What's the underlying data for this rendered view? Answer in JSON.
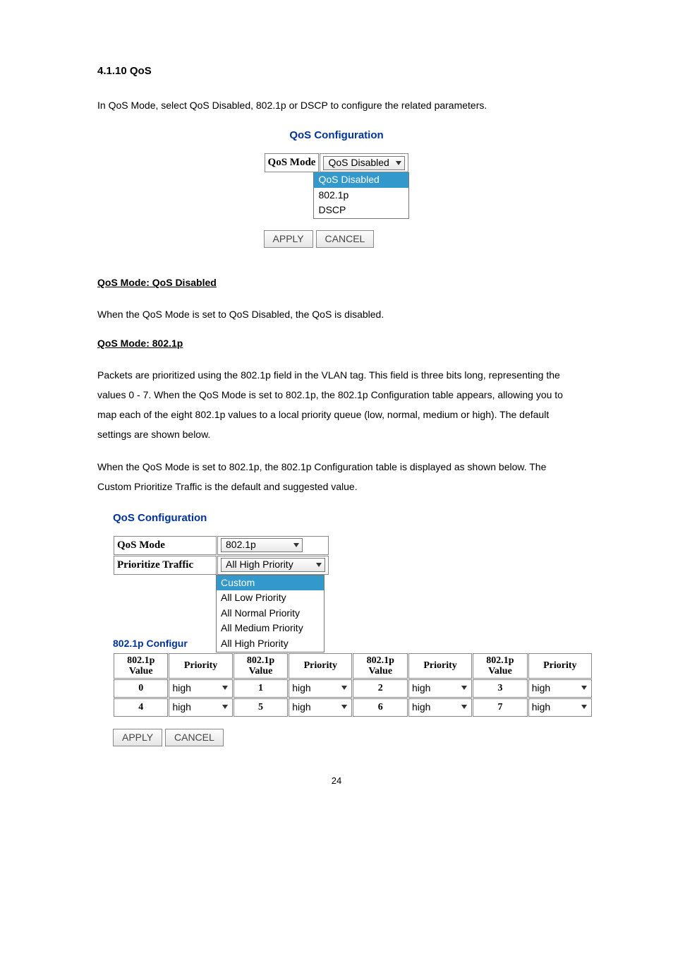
{
  "section_heading": "4.1.10 QoS",
  "intro_text": "In QoS Mode, select QoS Disabled, 802.1p or DSCP to configure the related parameters.",
  "config_title": "QoS Configuration",
  "qos_mode_label": "QoS Mode",
  "qos_mode_selected": "QoS Disabled",
  "qos_mode_options": {
    "opt0": "QoS Disabled",
    "opt1": "802.1p",
    "opt2": "DSCP"
  },
  "apply_label": "APPLY",
  "cancel_label": "CANCEL",
  "sub1_heading": "QoS Mode: QoS Disabled",
  "sub1_text": "When the QoS Mode is set to QoS Disabled, the QoS is disabled.",
  "sub2_heading": "QoS Mode: 802.1p",
  "sub2_text1": "Packets are prioritized using the 802.1p field in the VLAN tag. This field is three bits long, representing the values 0 - 7. When the QoS Mode is set to 802.1p, the 802.1p Configuration table appears, allowing you to map each of the eight 802.1p values to a local priority queue (low, normal, medium or high). The default settings are shown below.",
  "sub2_text2": "When the QoS Mode is set to 802.1p, the 802.1p Configuration table is displayed as shown below. The Custom Prioritize Traffic is the default and suggested value.",
  "qos_mode2_value": "802.1p",
  "prioritize_traffic_label": "Prioritize Traffic",
  "prioritize_selected": "All High Priority",
  "prioritize_options": {
    "p0": "Custom",
    "p1": "All Low Priority",
    "p2": "All Normal Priority",
    "p3": "All Medium Priority",
    "p4": "All High Priority"
  },
  "config_subtitle": "802.1p Configur",
  "col_value_a": "802.1p",
  "col_value_b": "Value",
  "col_priority": "Priority",
  "cfg_rows": {
    "r0": {
      "v0": "0",
      "p0": "high",
      "v1": "1",
      "p1": "high",
      "v2": "2",
      "p2": "high",
      "v3": "3",
      "p3": "high"
    },
    "r1": {
      "v0": "4",
      "p0": "high",
      "v1": "5",
      "p1": "high",
      "v2": "6",
      "p2": "high",
      "v3": "7",
      "p3": "high"
    }
  },
  "page_number": "24"
}
